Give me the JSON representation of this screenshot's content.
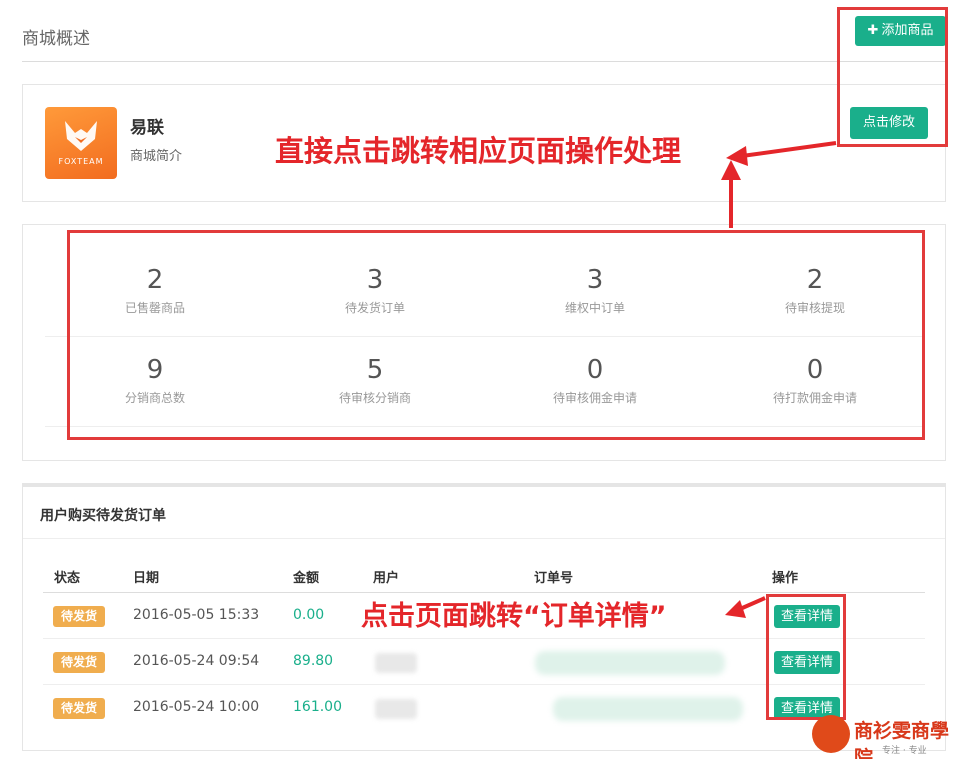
{
  "header": {
    "title": "商城概述",
    "add_button_icon": "plus-icon",
    "add_button_label": "添加商品"
  },
  "shop": {
    "logo_text": "FOXTEAM",
    "logo_icon": "fox-logo-icon",
    "name": "易联",
    "description": "商城简介",
    "edit_button_label": "点击修改"
  },
  "stats": [
    {
      "value": "2",
      "label": "已售罄商品"
    },
    {
      "value": "3",
      "label": "待发货订单"
    },
    {
      "value": "3",
      "label": "维权中订单"
    },
    {
      "value": "2",
      "label": "待审核提现"
    },
    {
      "value": "9",
      "label": "分销商总数"
    },
    {
      "value": "5",
      "label": "待审核分销商"
    },
    {
      "value": "0",
      "label": "待审核佣金申请"
    },
    {
      "value": "0",
      "label": "待打款佣金申请"
    }
  ],
  "orders": {
    "title": "用户购买待发货订单",
    "columns": [
      "状态",
      "日期",
      "金额",
      "用户",
      "订单号",
      "操作"
    ],
    "rows": [
      {
        "status": "待发货",
        "date": "2016-05-05 15:33",
        "amount": "0.00",
        "action": "查看详情"
      },
      {
        "status": "待发货",
        "date": "2016-05-24 09:54",
        "amount": "89.80",
        "action": "查看详情"
      },
      {
        "status": "待发货",
        "date": "2016-05-24 10:00",
        "amount": "161.00",
        "action": "查看详情"
      }
    ]
  },
  "annotations": {
    "top": "直接点击跳转相应页面操作处理",
    "bottom": "点击页面跳转“订单详情”"
  },
  "colors": {
    "accent": "#1aaf8b",
    "badge": "#f0ad4e",
    "annotation": "#e4262a"
  },
  "watermark": {
    "title": "商衫雯商學院",
    "subtitle": "专注 · 专业"
  }
}
